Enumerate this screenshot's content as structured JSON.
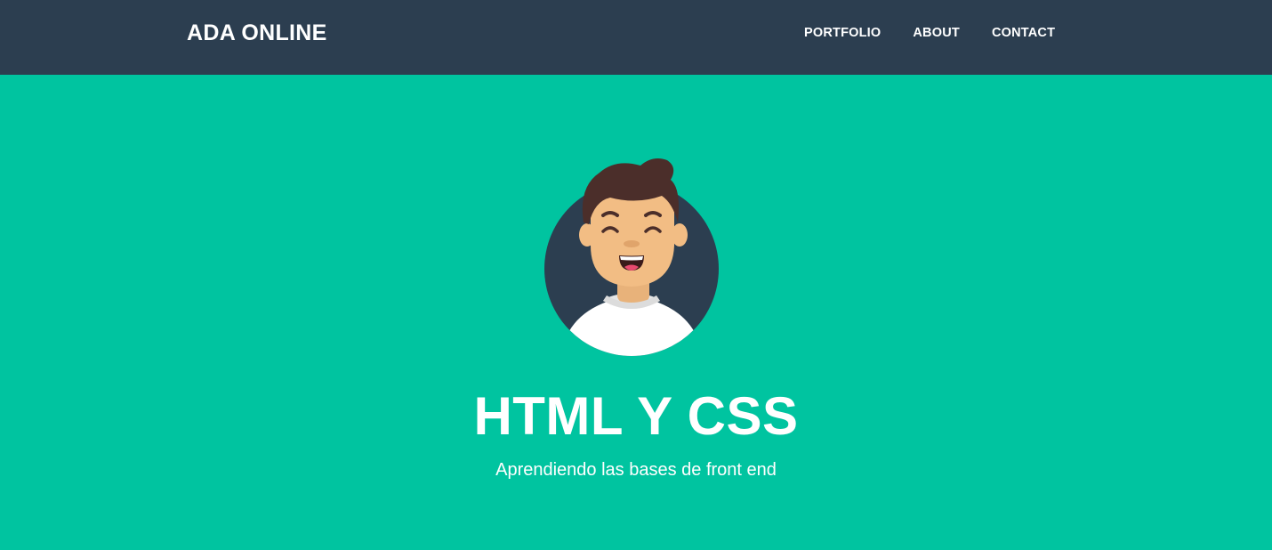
{
  "navbar": {
    "brand": "ADA ONLINE",
    "links": [
      {
        "label": "PORTFOLIO"
      },
      {
        "label": "ABOUT"
      },
      {
        "label": "CONTACT"
      }
    ],
    "background_color": "#2c3e50"
  },
  "hero": {
    "background_color": "#00c4a0",
    "avatar_icon": "smiling-person-avatar-icon",
    "title": "HTML Y CSS",
    "subtitle": "Aprendiendo las bases de front end"
  }
}
